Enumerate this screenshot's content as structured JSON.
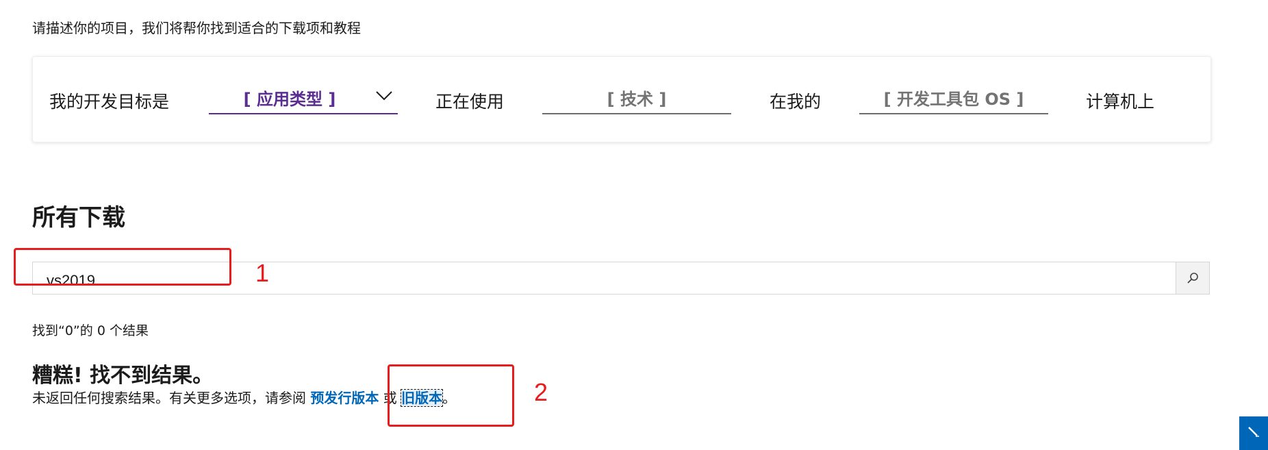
{
  "intro_text": "请描述你的项目，我们将帮你找到适合的下载项和教程",
  "picker": {
    "goal_label": "我的开发目标是",
    "app_type_value": "[ 应用类型 ]",
    "using_label": "正在使用",
    "tech_value": "[ 技术 ]",
    "on_my_label": "在我的",
    "os_value": "[ 开发工具包 OS ]",
    "computer_label": "计算机上",
    "accent_color": "#5c2d91"
  },
  "downloads": {
    "title": "所有下载",
    "search_value": "vs2019",
    "search_icon": "search-icon",
    "result_count": "找到“0”的 0 个结果",
    "oops_title": "糟糕! 找不到结果。",
    "no_results_prefix": "未返回任何搜索结果。有关更多选项，请参阅",
    "prerelease_link": "预发行版本",
    "or_text": "或",
    "older_link": "旧版本",
    "suffix": "。",
    "link_color": "#0067b8"
  },
  "annotations": {
    "label_1": "1",
    "label_2": "2",
    "color": "#e81c1c"
  },
  "feedback": {
    "icon": "pencil-icon",
    "color": "#0067b8"
  }
}
